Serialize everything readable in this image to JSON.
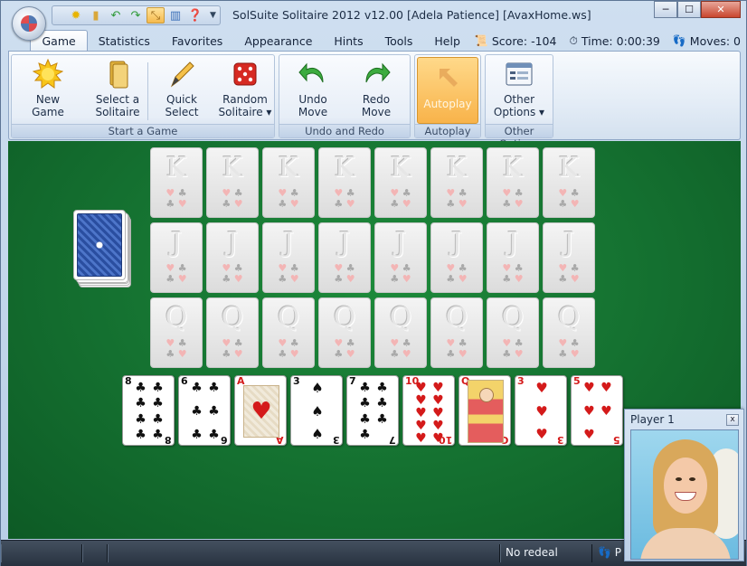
{
  "window": {
    "title": "SolSuite Solitaire 2012 v12.00  [Adela Patience]  [AvaxHome.ws]",
    "controls": {
      "minimize": "─",
      "maximize": "☐",
      "close": "✕"
    }
  },
  "quick_access": {
    "icons": [
      "new-game-icon",
      "select-solitaire-icon",
      "undo-icon",
      "redo-icon",
      "autoplay-icon",
      "statistics-icon",
      "help-icon"
    ],
    "dropdown": "▼"
  },
  "tabs": [
    "Game",
    "Statistics",
    "Favorites",
    "Appearance",
    "Hints",
    "Tools",
    "Help"
  ],
  "status_info": {
    "score_label": "Score:",
    "score_value": "-104",
    "time_label": "Time:",
    "time_value": "0:00:39",
    "moves_label": "Moves:",
    "moves_value": "0"
  },
  "ribbon": {
    "start_group": {
      "label": "Start a Game",
      "new_game": "New\nGame",
      "select_solitaire": "Select a\nSolitaire",
      "quick_select": "Quick\nSelect",
      "random_solitaire": "Random\nSolitaire ▾"
    },
    "undo_group": {
      "label": "Undo and Redo",
      "undo": "Undo\nMove",
      "redo": "Redo\nMove"
    },
    "autoplay_group": {
      "label": "Autoplay",
      "autoplay": "Autoplay"
    },
    "options_group": {
      "label": "Other Options",
      "other_options": "Other\nOptions ▾"
    }
  },
  "foundations": {
    "rows": [
      {
        "rank": "K",
        "count": 8
      },
      {
        "rank": "J",
        "count": 8
      },
      {
        "rank": "Q",
        "count": 8
      }
    ]
  },
  "tableau": [
    {
      "rank": "8",
      "suit": "♣",
      "color": "black"
    },
    {
      "rank": "6",
      "suit": "♣",
      "color": "black"
    },
    {
      "rank": "A",
      "suit": "♥",
      "color": "red"
    },
    {
      "rank": "3",
      "suit": "♠",
      "color": "black"
    },
    {
      "rank": "7",
      "suit": "♣",
      "color": "black"
    },
    {
      "rank": "10",
      "suit": "♥",
      "color": "red"
    },
    {
      "rank": "Q",
      "suit": "♥",
      "color": "red"
    },
    {
      "rank": "3",
      "suit": "♥",
      "color": "red"
    },
    {
      "rank": "5",
      "suit": "♥",
      "color": "red"
    }
  ],
  "statusbar": {
    "redeal": "No redeal",
    "player_short": "P"
  },
  "player_panel": {
    "title": "Player 1",
    "close": "x"
  }
}
